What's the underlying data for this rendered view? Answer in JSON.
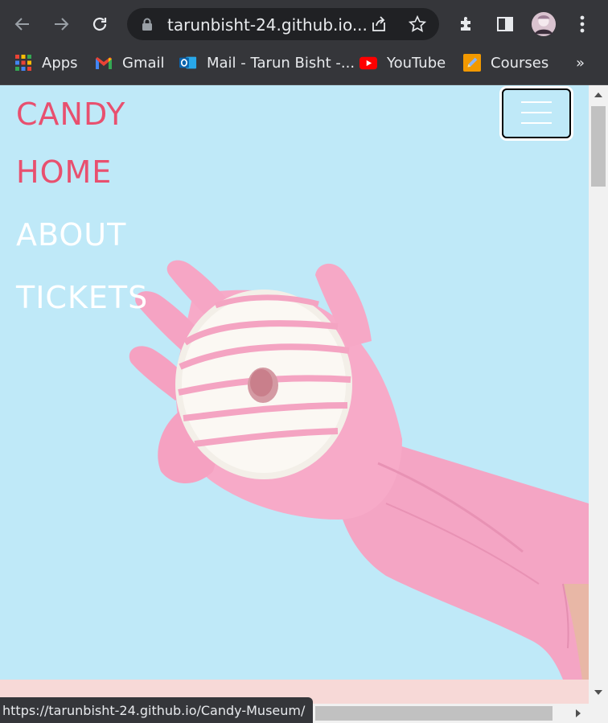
{
  "browser": {
    "url": "tarunbisht-24.github.io...",
    "bookmarks": [
      {
        "label": "Apps",
        "icon": "apps-grid-icon"
      },
      {
        "label": "Gmail",
        "icon": "gmail-icon"
      },
      {
        "label": "Mail - Tarun Bisht -...",
        "icon": "outlook-icon"
      },
      {
        "label": "YouTube",
        "icon": "youtube-icon"
      },
      {
        "label": "Courses",
        "icon": "pencil-icon"
      }
    ],
    "overflow": "»",
    "status_url": "https://tarunbisht-24.github.io/Candy-Museum/"
  },
  "page": {
    "brand": "CANDY",
    "nav": [
      "HOME",
      "ABOUT",
      "TICKETS"
    ],
    "colors": {
      "background": "#bfe9f8",
      "accent": "#e8506f",
      "glove": "#f7a8c8",
      "strip": "#f7d9d7"
    },
    "hero_image": "pink glove holding a white donut with pink stripes"
  }
}
